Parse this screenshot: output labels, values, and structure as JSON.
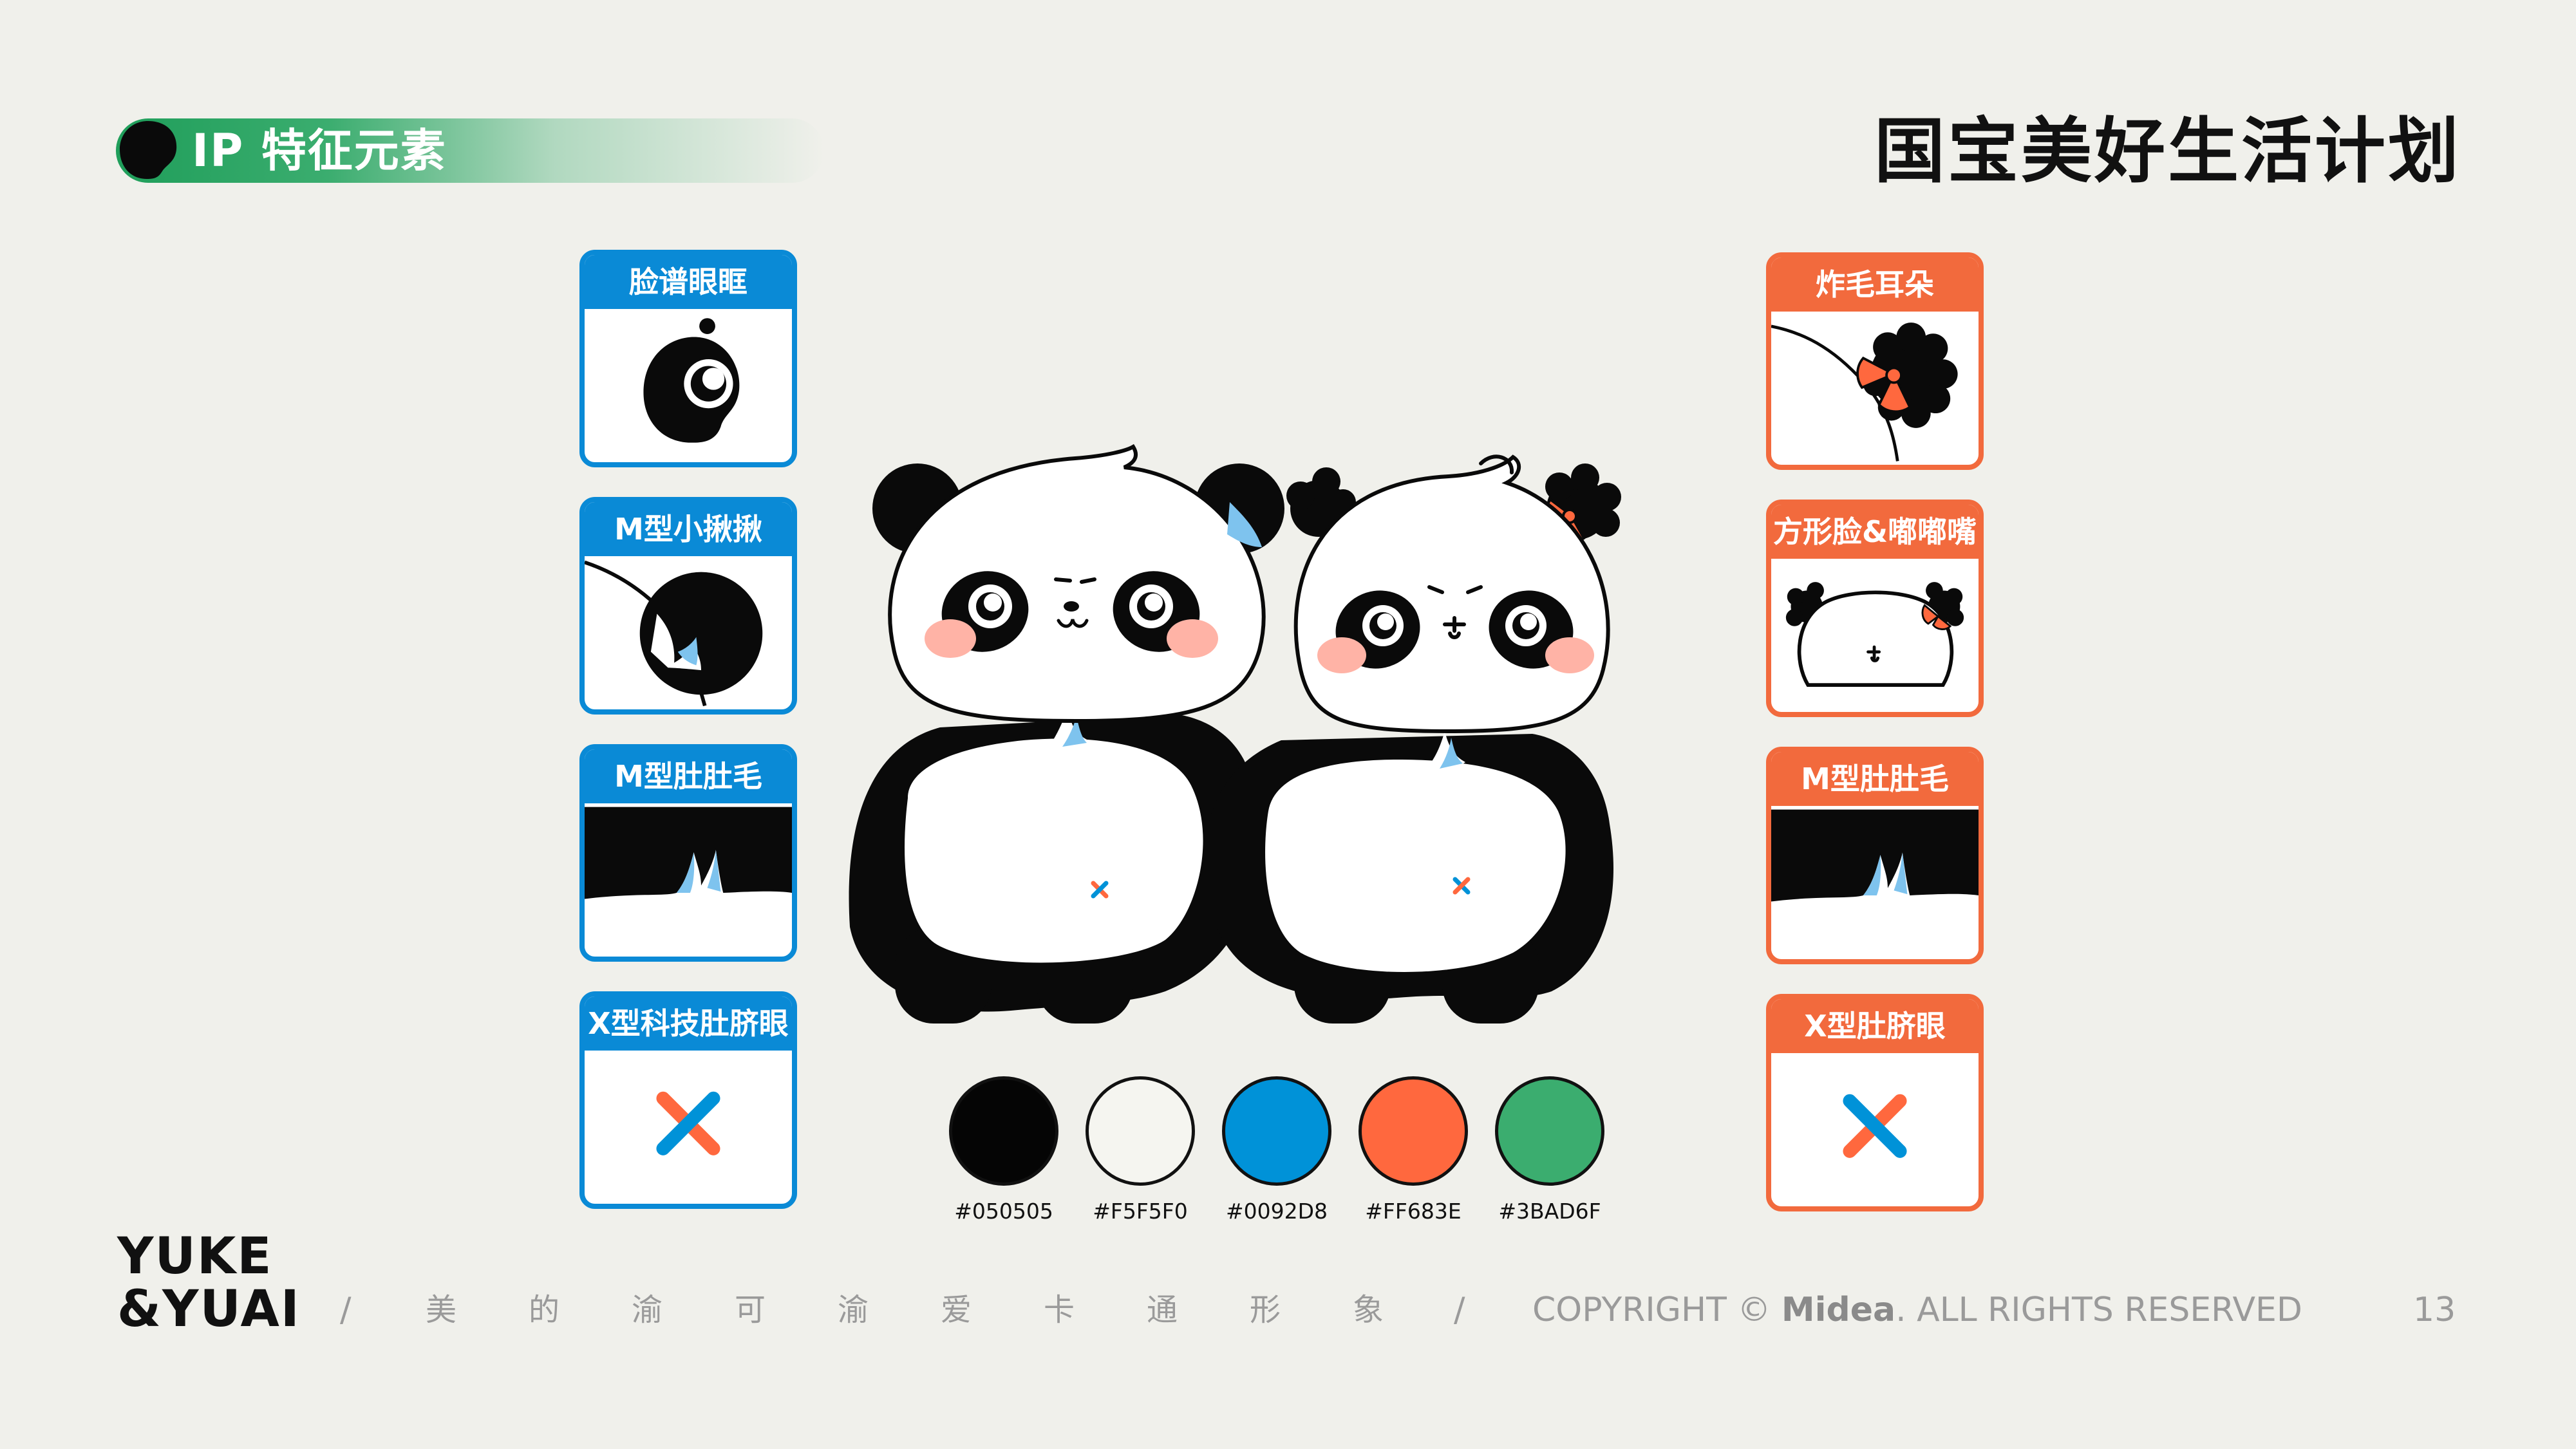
{
  "header": {
    "section_title": "IP 特征元素",
    "brand_title": "国宝美好生活计划"
  },
  "left_cards": [
    {
      "label": "脸谱眼眶",
      "icon": "eye-patch-icon"
    },
    {
      "label": "M型小揪揪",
      "icon": "head-tuft-icon"
    },
    {
      "label": "M型肚肚毛",
      "icon": "belly-fur-icon"
    },
    {
      "label": "X型科技肚脐眼",
      "icon": "x-navel-icon"
    }
  ],
  "right_cards": [
    {
      "label": "炸毛耳朵",
      "icon": "fluffy-ear-icon"
    },
    {
      "label": "方形脸&嘟嘟嘴",
      "icon": "square-face-icon"
    },
    {
      "label": "M型肚肚毛",
      "icon": "belly-fur-icon"
    },
    {
      "label": "X型肚脐眼",
      "icon": "x-navel-icon"
    }
  ],
  "palette": [
    {
      "hex": "#050505",
      "label": "#050505"
    },
    {
      "hex": "#F5F5F0",
      "label": "#F5F5F0"
    },
    {
      "hex": "#0092D8",
      "label": "#0092D8"
    },
    {
      "hex": "#FF683E",
      "label": "#FF683E"
    },
    {
      "hex": "#3BAD6F",
      "label": "#3BAD6F"
    }
  ],
  "colors": {
    "accent_blue": "#0A8AD6",
    "accent_orange": "#F26A3D",
    "accent_green": "#3BAD6F",
    "background": "#F0F0EB"
  },
  "footer": {
    "logo_line1": "YUKE",
    "logo_line2": "&YUAI",
    "separator": "/",
    "slogan_chars": [
      "美",
      "的",
      "渝",
      "可",
      "渝",
      "爱",
      "卡",
      "通",
      "形",
      "象"
    ],
    "copyright_prefix": "COPYRIGHT © ",
    "copyright_brand": "Midea",
    "copyright_suffix": ". ALL RIGHTS RESERVED",
    "page_number": "13"
  }
}
